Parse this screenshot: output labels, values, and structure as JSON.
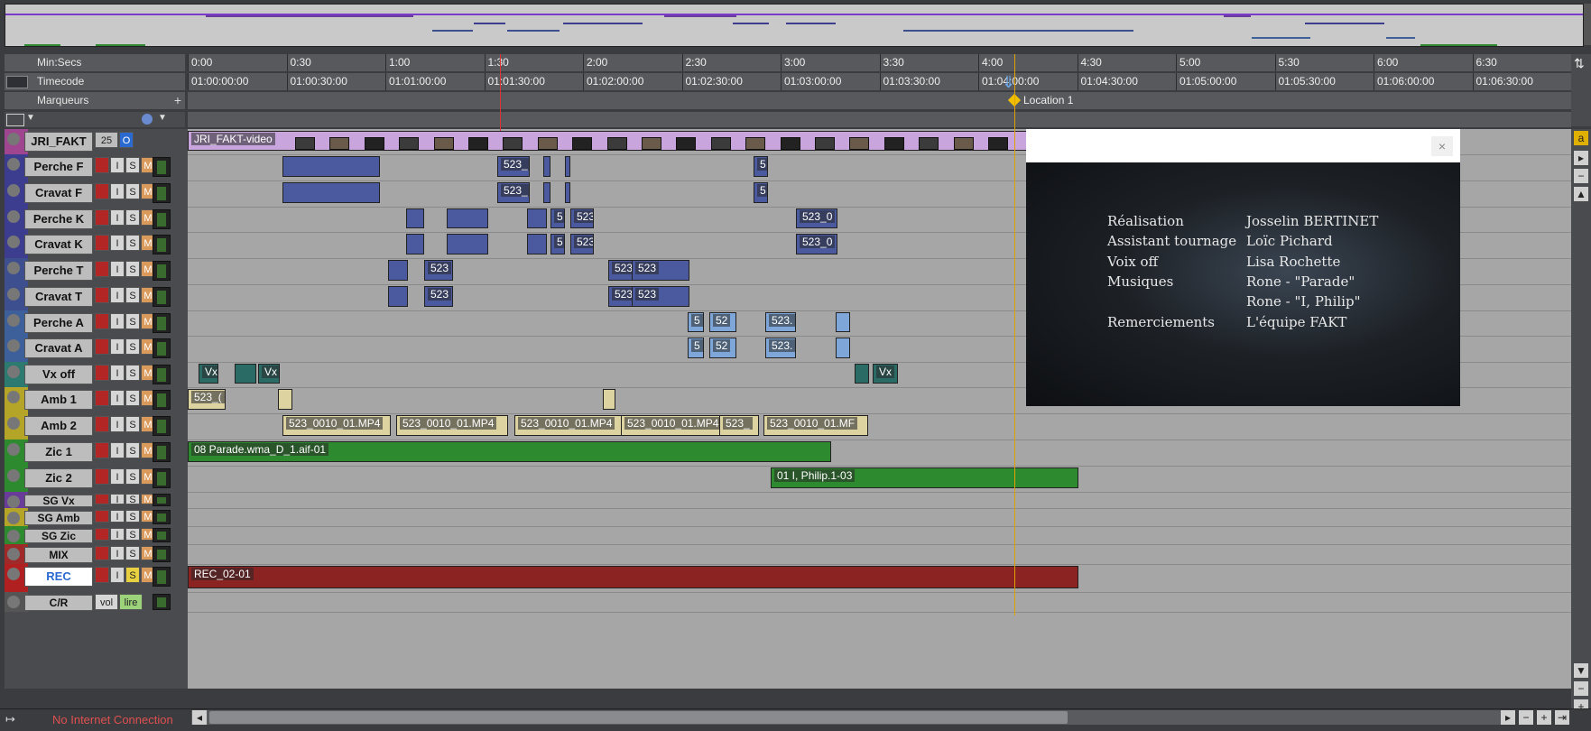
{
  "ruler": {
    "minsecs_label": "Min:Secs",
    "timecode_label": "Timecode",
    "markers_label": "Marqueurs",
    "minsecs_ticks": [
      "0:00",
      "0:30",
      "1:00",
      "1:30",
      "2:00",
      "2:30",
      "3:00",
      "3:30",
      "4:00",
      "4:30",
      "5:00",
      "5:30",
      "6:00",
      "6:30"
    ],
    "timecode_ticks": [
      "01:00:00:00",
      "01:00:30:00",
      "01:01:00:00",
      "01:01:30:00",
      "01:02:00:00",
      "01:02:30:00",
      "01:03:00:00",
      "01:03:30:00",
      "01:04:00:00",
      "01:04:30:00",
      "01:05:00:00",
      "01:05:30:00",
      "01:06:00:00",
      "01:06:30:00"
    ],
    "marker_name": "Location 1",
    "add_marker": "+"
  },
  "tracks": [
    {
      "name": "JRI_FAKT",
      "kind": "video",
      "color": "#a0458f",
      "badge": "25",
      "badge2": "O"
    },
    {
      "name": "Perche F",
      "kind": "audio",
      "color": "#3d3d8f"
    },
    {
      "name": "Cravat F",
      "kind": "audio",
      "color": "#3d3d8f"
    },
    {
      "name": "Perche K",
      "kind": "audio",
      "color": "#3d3d8f"
    },
    {
      "name": "Cravat K",
      "kind": "audio",
      "color": "#3d3d8f"
    },
    {
      "name": "Perche T",
      "kind": "audio",
      "color": "#3d4f8f"
    },
    {
      "name": "Cravat T",
      "kind": "audio",
      "color": "#3d4f8f"
    },
    {
      "name": "Perche A",
      "kind": "audio",
      "color": "#3d5f9a"
    },
    {
      "name": "Cravat  A",
      "kind": "audio",
      "color": "#3d5f9a"
    },
    {
      "name": "Vx off",
      "kind": "audio",
      "color": "#2d7a70"
    },
    {
      "name": "Amb 1",
      "kind": "audio",
      "color": "#b4a428"
    },
    {
      "name": "Amb 2",
      "kind": "audio",
      "color": "#b4a428"
    },
    {
      "name": "Zic 1",
      "kind": "audio",
      "color": "#2e8a2e"
    },
    {
      "name": "Zic 2",
      "kind": "audio",
      "color": "#2e8a2e"
    },
    {
      "name": "SG Vx",
      "kind": "aux",
      "color": "#6a3c9a"
    },
    {
      "name": "SG Amb",
      "kind": "aux",
      "color": "#b4a428"
    },
    {
      "name": "SG Zic",
      "kind": "aux",
      "color": "#2e8a2e"
    },
    {
      "name": "MIX",
      "kind": "aux",
      "color": "#a02a2a"
    },
    {
      "name": "REC",
      "kind": "rec",
      "color": "#b02020"
    },
    {
      "name": "C/R",
      "kind": "cr",
      "color": "#555555"
    }
  ],
  "button_labels": {
    "i": "I",
    "s": "S",
    "m": "M",
    "vol": "vol",
    "lire": "lire"
  },
  "clips": {
    "video": "JRI_FAKT-video",
    "c523": "523",
    "c523_": "523_",
    "c523_0": "523_0",
    "c5": "5",
    "c52": "52",
    "c523mp4": "523_0010_01.MP4",
    "c523mp4short": "523_0010_01.MF",
    "c523short2": "523_",
    "c523dot": "523.",
    "vx": "Vx",
    "amb1": "523_(",
    "zic1": "08 Parade.wma_D_1.aif-01",
    "zic2": "01 I, Philip.1-03",
    "rec": "REC_02-01"
  },
  "video_window": {
    "close": "×",
    "credits": [
      [
        "Réalisation",
        "Josselin BERTINET"
      ],
      [
        "Assistant tournage",
        "Loïc Pichard"
      ],
      [
        "Voix off",
        "Lisa Rochette"
      ],
      [
        "Musiques",
        "Rone - \"Parade\""
      ],
      [
        "",
        "Rone - \"I, Philip\""
      ],
      [
        "Remerciements",
        "L'équipe FAKT"
      ]
    ]
  },
  "status": {
    "internet": "No Internet Connection",
    "internet_color": "#e05050"
  },
  "colors": {
    "playhead": "#d33333",
    "accent_purple": "#7a3cc8"
  }
}
